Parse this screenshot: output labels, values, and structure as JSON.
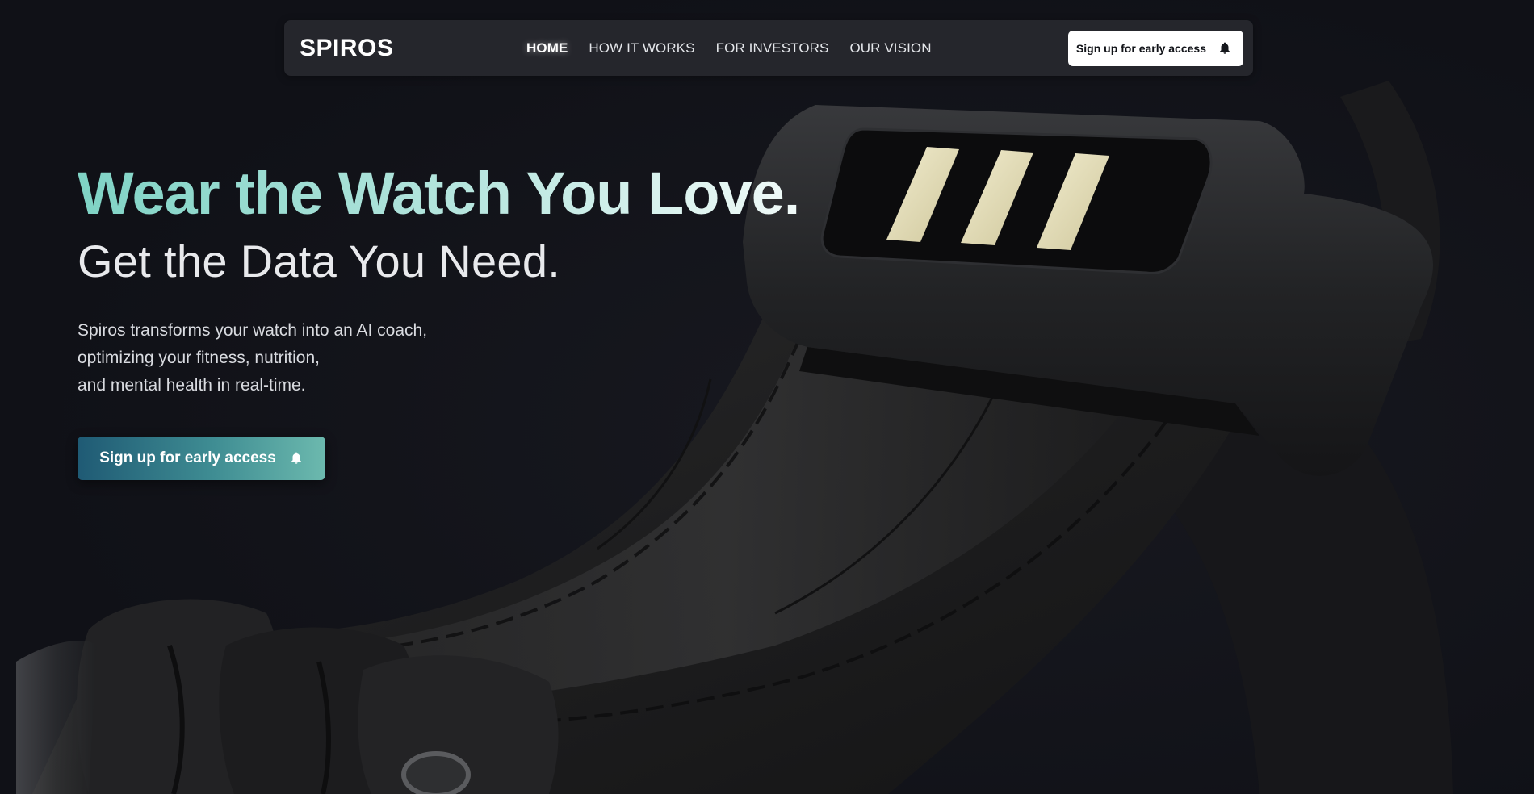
{
  "nav": {
    "brand": "SPIROS",
    "links": [
      {
        "label": "HOME",
        "active": true
      },
      {
        "label": "HOW IT WORKS",
        "active": false
      },
      {
        "label": "FOR INVESTORS",
        "active": false
      },
      {
        "label": "OUR VISION",
        "active": false
      }
    ],
    "cta_label": "Sign up for early access",
    "cta_icon": "bell-icon"
  },
  "hero": {
    "headline": "Wear the Watch You Love.",
    "subheadline": "Get the Data You Need.",
    "description_lines": [
      "Spiros transforms your watch into an AI coach,",
      "optimizing your fitness, nutrition,",
      "and mental health in real-time."
    ],
    "cta_label": "Sign up for early access",
    "cta_icon": "bell-icon"
  },
  "colors": {
    "background": "#101117",
    "nav_background": "#25262c",
    "accent_teal": "#7fd3c5",
    "cta_gradient_start": "#1f5a74",
    "cta_gradient_end": "#6cb9ae",
    "contact_pins": "#e9e3bf"
  }
}
